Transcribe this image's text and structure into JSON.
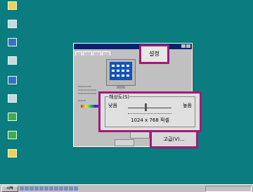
{
  "dialog": {
    "tab_settings_label": "설정",
    "resolution_group_title": "해상도(S)",
    "resolution_low_label": "낮음",
    "resolution_high_label": "높음",
    "resolution_value": "1024 x 768 픽셀",
    "advanced_button_label": "고급(V)...",
    "resolution_slider_level": 0.4
  },
  "taskbar": {
    "start_label": "시작"
  },
  "colors": {
    "callout_border": "#a11a78",
    "desktop": "#0b7c80",
    "title_bar": "#0a246a"
  }
}
